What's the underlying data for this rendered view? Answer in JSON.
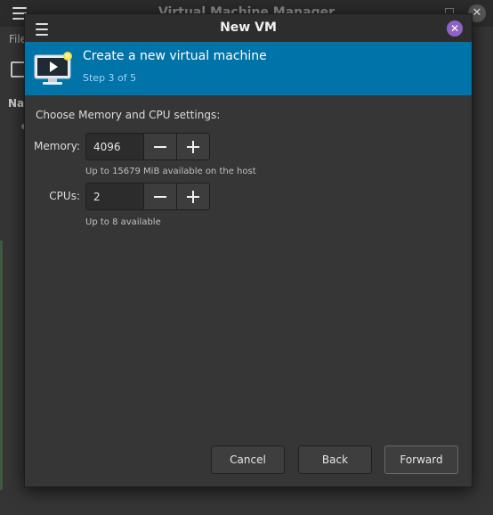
{
  "parent": {
    "title": "Virtual Machine Manager",
    "menu_partial": "File",
    "column_partial": "Na"
  },
  "dialog": {
    "title": "New VM",
    "banner": {
      "title": "Create a new virtual machine",
      "step": "Step 3 of 5",
      "icon": "vm-screen-icon"
    },
    "section_label": "Choose Memory and CPU settings:",
    "memory": {
      "label": "Memory:",
      "value": "4096",
      "hint": "Up to 15679 MiB available on the host"
    },
    "cpus": {
      "label": "CPUs:",
      "value": "2",
      "hint": "Up to 8 available"
    },
    "buttons": {
      "cancel": "Cancel",
      "back": "Back",
      "forward": "Forward"
    }
  },
  "colors": {
    "banner": "#0073a8",
    "close_accent": "#8f62c8",
    "background": "#363636"
  }
}
